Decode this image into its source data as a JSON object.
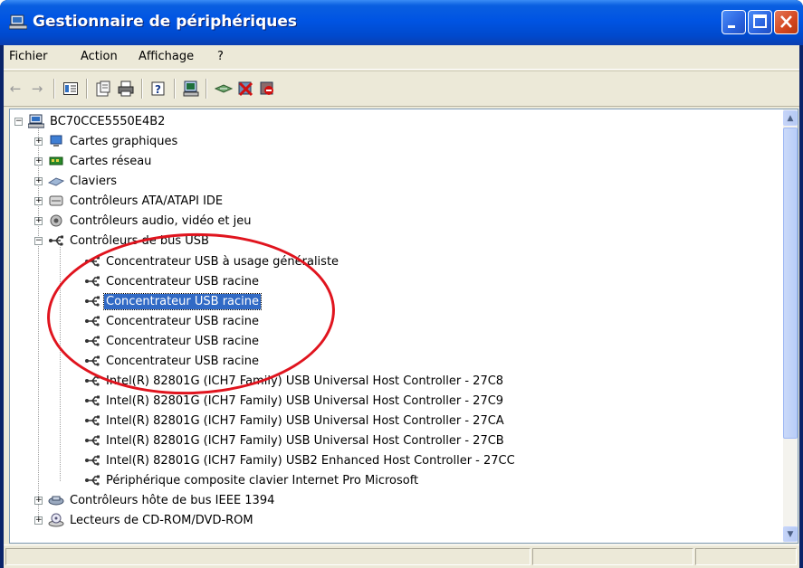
{
  "window": {
    "title": "Gestionnaire de périphériques",
    "controls": [
      "minimize",
      "maximize",
      "close"
    ]
  },
  "menu": [
    {
      "label": "Fichier"
    },
    {
      "label": "Action"
    },
    {
      "label": "Affichage"
    },
    {
      "label": "?"
    }
  ],
  "toolbar": {
    "icons": [
      "back-icon",
      "forward-icon",
      "console-tree-icon",
      "properties-icon",
      "print-icon",
      "help-icon",
      "scan-hardware-icon",
      "update-driver-icon",
      "disable-device-icon",
      "uninstall-device-icon"
    ]
  },
  "tree": {
    "root": {
      "label": "BC70CCE5550E4B2",
      "icon": "computer-icon"
    },
    "categories": [
      {
        "label": "Cartes graphiques",
        "icon": "display-adapter-icon"
      },
      {
        "label": "Cartes réseau",
        "icon": "network-card-icon"
      },
      {
        "label": "Claviers",
        "icon": "keyboard-icon"
      },
      {
        "label": "Contrôleurs ATA/ATAPI IDE",
        "icon": "ide-controller-icon"
      },
      {
        "label": "Contrôleurs audio, vidéo et jeu",
        "icon": "audio-icon"
      },
      {
        "label": "Contrôleurs de bus USB",
        "icon": "usb-icon",
        "expanded": true
      }
    ],
    "usb_children": [
      {
        "label": "Concentrateur USB à usage généraliste",
        "icon": "usb-icon",
        "selected": false
      },
      {
        "label": "Concentrateur USB racine",
        "icon": "usb-icon",
        "selected": false
      },
      {
        "label": "Concentrateur USB racine",
        "icon": "usb-icon",
        "selected": true
      },
      {
        "label": "Concentrateur USB racine",
        "icon": "usb-icon",
        "selected": false
      },
      {
        "label": "Concentrateur USB racine",
        "icon": "usb-icon",
        "selected": false
      },
      {
        "label": "Concentrateur USB racine",
        "icon": "usb-icon",
        "selected": false
      },
      {
        "label": "Intel(R) 82801G (ICH7 Family) USB Universal Host Controller - 27C8",
        "icon": "usb-icon",
        "selected": false
      },
      {
        "label": "Intel(R) 82801G (ICH7 Family) USB Universal Host Controller - 27C9",
        "icon": "usb-icon",
        "selected": false
      },
      {
        "label": "Intel(R) 82801G (ICH7 Family) USB Universal Host Controller - 27CA",
        "icon": "usb-icon",
        "selected": false
      },
      {
        "label": "Intel(R) 82801G (ICH7 Family) USB Universal Host Controller - 27CB",
        "icon": "usb-icon",
        "selected": false
      },
      {
        "label": "Intel(R) 82801G (ICH7 Family) USB2 Enhanced Host Controller - 27CC",
        "icon": "usb-icon",
        "selected": false
      },
      {
        "label": "Périphérique composite clavier Internet Pro Microsoft",
        "icon": "usb-icon",
        "selected": false
      }
    ],
    "after": [
      {
        "label": "Contrôleurs hôte de bus IEEE 1394",
        "icon": "firewire-icon"
      },
      {
        "label": "Lecteurs de CD-ROM/DVD-ROM",
        "icon": "cdrom-icon"
      }
    ]
  },
  "colors": {
    "selection": "#316ac5",
    "annotation": "#e0141e",
    "titlebar": "#0054e3"
  }
}
